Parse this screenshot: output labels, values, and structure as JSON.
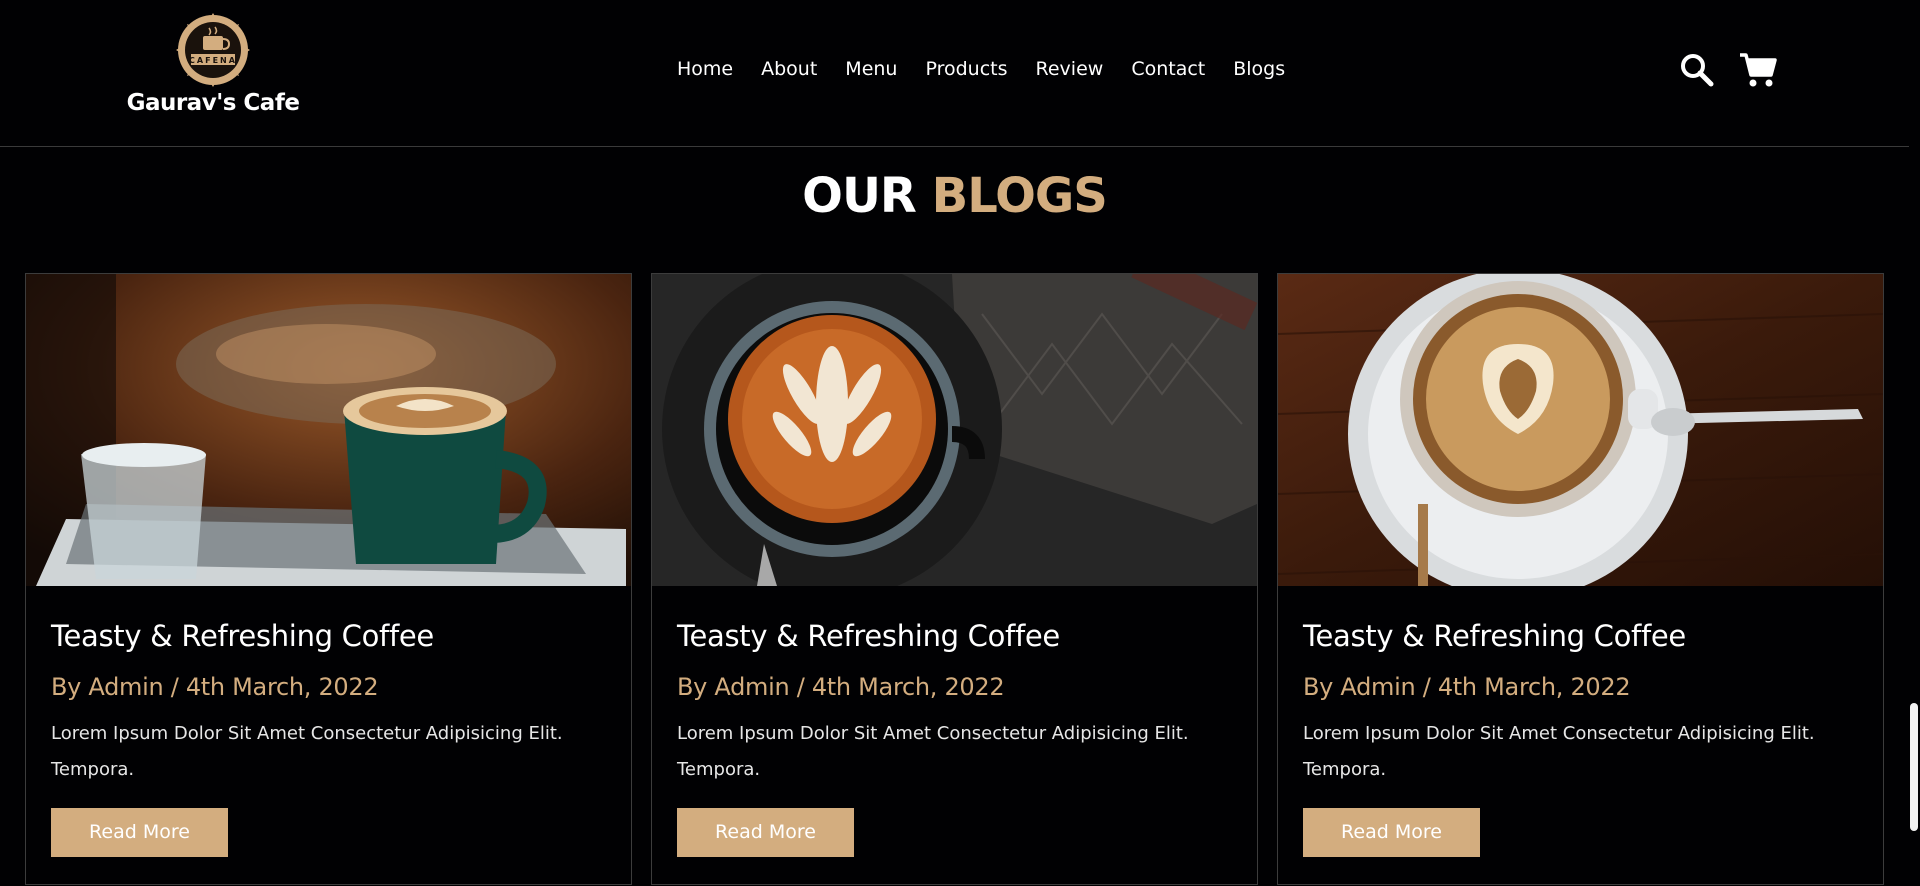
{
  "brand": {
    "name": "Gaurav's Cafe",
    "badge_text": "CAFENA"
  },
  "nav": {
    "items": [
      {
        "label": "Home"
      },
      {
        "label": "About"
      },
      {
        "label": "Menu"
      },
      {
        "label": "Products"
      },
      {
        "label": "Review"
      },
      {
        "label": "Contact"
      },
      {
        "label": "Blogs"
      }
    ]
  },
  "header_icons": [
    "search-icon",
    "cart-icon"
  ],
  "section": {
    "title_word1": "OUR",
    "title_word2": "BLOGS"
  },
  "colors": {
    "accent": "#d3ad7f",
    "background": "#010103"
  },
  "blogs": [
    {
      "image": "latte-green-cup-with-water-glass",
      "title": "Teasty & Refreshing Coffee",
      "meta": "By Admin / 4th March, 2022",
      "desc": "Lorem Ipsum Dolor Sit Amet Consectetur Adipisicing Elit. Tempora.",
      "button": "Read More"
    },
    {
      "image": "latte-art-black-cup-topview",
      "title": "Teasty & Refreshing Coffee",
      "meta": "By Admin / 4th March, 2022",
      "desc": "Lorem Ipsum Dolor Sit Amet Consectetur Adipisicing Elit. Tempora.",
      "button": "Read More"
    },
    {
      "image": "cappuccino-white-cup-with-spoon",
      "title": "Teasty & Refreshing Coffee",
      "meta": "By Admin / 4th March, 2022",
      "desc": "Lorem Ipsum Dolor Sit Amet Consectetur Adipisicing Elit. Tempora.",
      "button": "Read More"
    }
  ]
}
